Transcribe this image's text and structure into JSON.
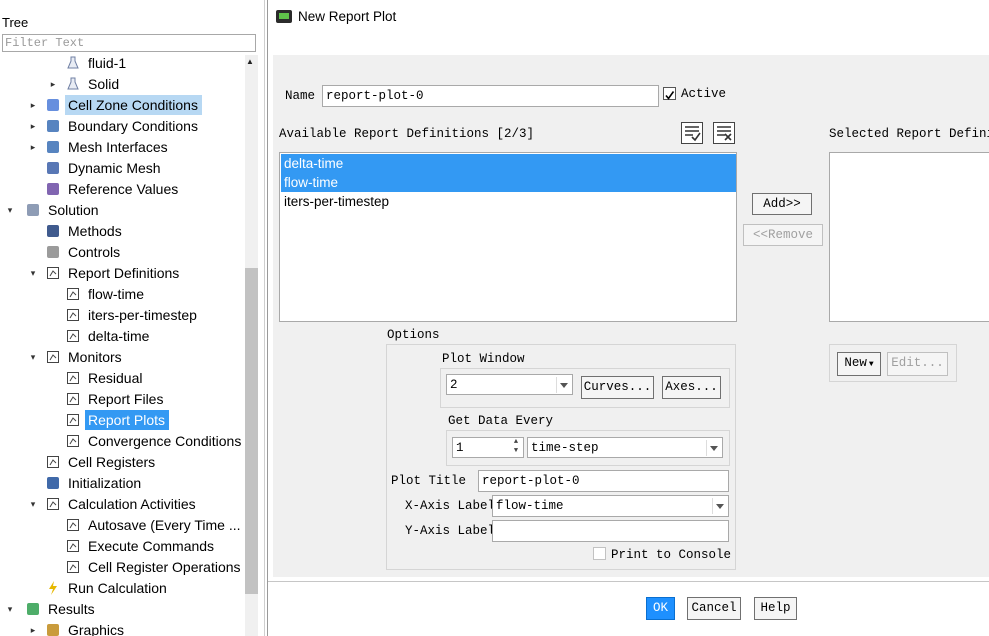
{
  "tree": {
    "header": "Tree",
    "filter_placeholder": "Filter Text",
    "items": [
      {
        "label": "fluid-1",
        "icon": "flask-icon",
        "toggle": "",
        "indent": 2,
        "state": ""
      },
      {
        "label": "Solid",
        "icon": "flask-icon",
        "toggle": "▸",
        "indent": 2,
        "state": ""
      },
      {
        "label": "Cell Zone Conditions",
        "icon": "cell-zone-icon",
        "toggle": "▸",
        "indent": 1,
        "state": "soft"
      },
      {
        "label": "Boundary Conditions",
        "icon": "boundary-icon",
        "toggle": "▸",
        "indent": 1,
        "state": ""
      },
      {
        "label": "Mesh Interfaces",
        "icon": "mesh-interface-icon",
        "toggle": "▸",
        "indent": 1,
        "state": ""
      },
      {
        "label": "Dynamic Mesh",
        "icon": "dynamic-mesh-icon",
        "toggle": "",
        "indent": 1,
        "state": ""
      },
      {
        "label": "Reference Values",
        "icon": "reference-values-icon",
        "toggle": "",
        "indent": 1,
        "state": ""
      },
      {
        "label": "Solution",
        "icon": "solution-icon",
        "toggle": "▾",
        "indent": 0,
        "state": ""
      },
      {
        "label": "Methods",
        "icon": "methods-icon",
        "toggle": "",
        "indent": 1,
        "state": ""
      },
      {
        "label": "Controls",
        "icon": "controls-icon",
        "toggle": "",
        "indent": 1,
        "state": ""
      },
      {
        "label": "Report Definitions",
        "icon": "report-icon",
        "toggle": "▾",
        "indent": 1,
        "state": ""
      },
      {
        "label": "flow-time",
        "icon": "report-icon",
        "toggle": "",
        "indent": 2,
        "state": ""
      },
      {
        "label": "iters-per-timestep",
        "icon": "report-icon",
        "toggle": "",
        "indent": 2,
        "state": ""
      },
      {
        "label": "delta-time",
        "icon": "report-icon",
        "toggle": "",
        "indent": 2,
        "state": ""
      },
      {
        "label": "Monitors",
        "icon": "monitor-icon",
        "toggle": "▾",
        "indent": 1,
        "state": ""
      },
      {
        "label": "Residual",
        "icon": "report-icon",
        "toggle": "",
        "indent": 2,
        "state": ""
      },
      {
        "label": "Report Files",
        "icon": "report-icon",
        "toggle": "",
        "indent": 2,
        "state": ""
      },
      {
        "label": "Report Plots",
        "icon": "report-icon",
        "toggle": "",
        "indent": 2,
        "state": "sel"
      },
      {
        "label": "Convergence Conditions",
        "icon": "report-icon",
        "toggle": "",
        "indent": 2,
        "state": ""
      },
      {
        "label": "Cell Registers",
        "icon": "report-icon",
        "toggle": "",
        "indent": 1,
        "state": ""
      },
      {
        "label": "Initialization",
        "icon": "initialization-icon",
        "toggle": "",
        "indent": 1,
        "state": ""
      },
      {
        "label": "Calculation Activities",
        "icon": "activities-icon",
        "toggle": "▾",
        "indent": 1,
        "state": ""
      },
      {
        "label": "Autosave (Every Time ...",
        "icon": "activities-icon",
        "toggle": "",
        "indent": 2,
        "state": ""
      },
      {
        "label": "Execute Commands",
        "icon": "activities-icon",
        "toggle": "",
        "indent": 2,
        "state": ""
      },
      {
        "label": "Cell Register Operations",
        "icon": "activities-icon",
        "toggle": "",
        "indent": 2,
        "state": ""
      },
      {
        "label": "Run Calculation",
        "icon": "run-calculation-icon",
        "toggle": "",
        "indent": 1,
        "state": ""
      },
      {
        "label": "Results",
        "icon": "results-icon",
        "toggle": "▾",
        "indent": 0,
        "state": ""
      },
      {
        "label": "Graphics",
        "icon": "graphics-icon",
        "toggle": "▸",
        "indent": 1,
        "state": ""
      }
    ]
  },
  "dialog": {
    "title": "New Report Plot",
    "name_label": "Name",
    "name_value": "report-plot-0",
    "active_label": "Active",
    "active_checked": true,
    "available_label": "Available Report Definitions [2/3]",
    "available_items": [
      {
        "label": "delta-time",
        "selected": true
      },
      {
        "label": "flow-time",
        "selected": true
      },
      {
        "label": "iters-per-timestep",
        "selected": false
      }
    ],
    "selected_label": "Selected Report Definiti",
    "add_button": "Add>>",
    "remove_button": "<<Remove",
    "options_label": "Options",
    "plot_window_label": "Plot Window",
    "plot_window_value": "2",
    "curves_button": "Curves...",
    "axes_button": "Axes...",
    "get_data_every_label": "Get Data Every",
    "get_data_every_value": "1",
    "get_data_unit": "time-step",
    "plot_title_label": "Plot Title",
    "plot_title_value": "report-plot-0",
    "x_axis_label": "X-Axis Label",
    "x_axis_value": "flow-time",
    "y_axis_label": "Y-Axis Label",
    "y_axis_value": "",
    "print_console_label": "Print to Console",
    "print_console_checked": false,
    "new_button": "New",
    "edit_button": "Edit...",
    "ok_button": "OK",
    "cancel_button": "Cancel",
    "help_button": "Help"
  },
  "colors": {
    "selection": "#3399f3",
    "soft_selection": "#b7d8f3",
    "panel_bg": "#f0f0f0"
  }
}
